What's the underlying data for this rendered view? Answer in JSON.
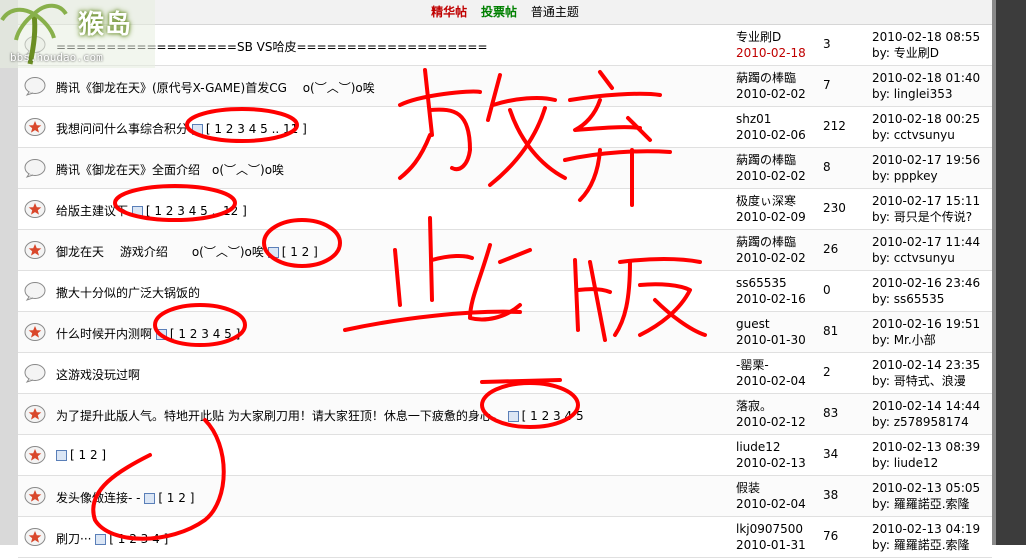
{
  "logo": {
    "brand": "猴岛",
    "url": "bbs.houdao.com"
  },
  "tabs": [
    {
      "label": "精华帖"
    },
    {
      "label": "投票帖"
    },
    {
      "label": "普通主题"
    }
  ],
  "threads": [
    {
      "icon": "bubble",
      "title": "==================SB VS哈皮===================",
      "pages": "",
      "author": "专业刷D",
      "post_date": "2010-02-18",
      "post_date_red": true,
      "replies": "3",
      "last_time": "2010-02-18 08:55",
      "last_by": "by: 专业刷D"
    },
    {
      "icon": "bubble",
      "title": "腾讯《御龙在天》(原代号X-GAME)首发CG　 o(︶︿︶)o唉",
      "pages": "",
      "author": "蒳躅の棒臨",
      "post_date": "2010-02-02",
      "replies": "7",
      "last_time": "2010-02-18 01:40",
      "last_by": "by: linglei353"
    },
    {
      "icon": "hot",
      "title": "我想问问什么事综合积分",
      "pages": "[ 1 2 3 4 5 .. 11 ]",
      "author": "shz01",
      "post_date": "2010-02-06",
      "replies": "212",
      "last_time": "2010-02-18 00:25",
      "last_by": "by: cctvsunyu"
    },
    {
      "icon": "bubble",
      "title": "腾讯《御龙在天》全面介绍　o(︶︿︶)o唉",
      "pages": "",
      "author": "蒳躅の棒臨",
      "post_date": "2010-02-02",
      "replies": "8",
      "last_time": "2010-02-17 19:56",
      "last_by": "by: pppkey"
    },
    {
      "icon": "hot",
      "title": "给版主建议下",
      "pages": "[ 1 2 3 4 5 .. 12 ]",
      "author": "极度ぃ深寒",
      "post_date": "2010-02-09",
      "replies": "230",
      "last_time": "2010-02-17 15:11",
      "last_by": "by: 哥只是个传说?"
    },
    {
      "icon": "hot",
      "title": "御龙在天　 游戏介绍　　o(︶︿︶)o唉",
      "pages": "[ 1 2 ]",
      "author": "蒳躅の棒臨",
      "post_date": "2010-02-02",
      "replies": "26",
      "last_time": "2010-02-17 11:44",
      "last_by": "by: cctvsunyu"
    },
    {
      "icon": "bubble",
      "title": "撒大十分似的广泛大锅饭的",
      "pages": "",
      "author": "ss65535",
      "post_date": "2010-02-16",
      "replies": "0",
      "last_time": "2010-02-16 23:46",
      "last_by": "by: ss65535"
    },
    {
      "icon": "hot",
      "title": "什么时候开内测啊",
      "pages": "[ 1 2 3 4 5 ]",
      "author": "guest",
      "post_date": "2010-01-30",
      "replies": "81",
      "last_time": "2010-02-16 19:51",
      "last_by": "by: Mr.小部"
    },
    {
      "icon": "bubble",
      "title": "这游戏没玩过啊",
      "pages": "",
      "author": "-罂栗-",
      "post_date": "2010-02-04",
      "replies": "2",
      "last_time": "2010-02-14 23:35",
      "last_by": "by: 哥特式、浪漫"
    },
    {
      "icon": "hot",
      "title": "为了提升此版人气。特地开此贴 为大家刷刀用！请大家狂顶！休息一下疲惫的身心。",
      "pages": "[ 1 2 3 4 5",
      "author": "落寂。",
      "post_date": "2010-02-12",
      "replies": "83",
      "last_time": "2010-02-14 14:44",
      "last_by": "by: z578958174"
    },
    {
      "icon": "hot",
      "title": "",
      "pages": "[ 1 2 ]",
      "author": "liude12",
      "post_date": "2010-02-13",
      "replies": "34",
      "last_time": "2010-02-13 08:39",
      "last_by": "by: liude12"
    },
    {
      "icon": "hot",
      "title": "发头像做连接- -",
      "pages": "[ 1 2 ]",
      "author": "假装",
      "post_date": "2010-02-04",
      "replies": "38",
      "last_time": "2010-02-13 05:05",
      "last_by": "by: 羅羅諾亞.索隆"
    },
    {
      "icon": "hot",
      "title": "刷刀···",
      "pages": "[ 1 2 3 4 ]",
      "author": "lkj0907500",
      "post_date": "2010-01-31",
      "replies": "76",
      "last_time": "2010-02-13 04:19",
      "last_by": "by: 羅羅諾亞.索隆"
    }
  ],
  "colors": {
    "scribble": "#ff0000",
    "digest": "#c00000",
    "poll": "#008000"
  }
}
